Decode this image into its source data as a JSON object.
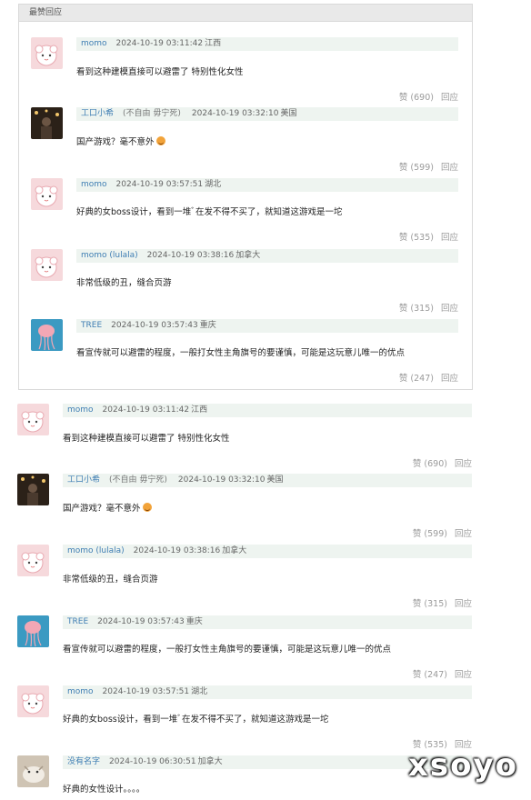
{
  "section_title": "最赞回应",
  "watermark": "xsoyo",
  "hot": [
    {
      "user": "momo",
      "sub": "",
      "time": "2024-10-19 03:11:42",
      "loc": "江西",
      "text": "看到这种建模直接可以避雷了 特别性化女性",
      "emoji": false,
      "likes": "赞 (690)",
      "reply": "回应",
      "avatar": "pink-blob"
    },
    {
      "user": "工口小希",
      "sub": "(不自由 毋宁死)",
      "time": "2024-10-19 03:32:10",
      "loc": "美国",
      "text": "国产游戏？毫不意外",
      "emoji": true,
      "likes": "赞 (599)",
      "reply": "回应",
      "avatar": "dark-photo"
    },
    {
      "user": "momo",
      "sub": "",
      "time": "2024-10-19 03:57:51",
      "loc": "湖北",
      "text": "好典的女boss设计，看到一堆ﾞ在发不得不买了，就知道这游戏是一坨",
      "emoji": false,
      "likes": "赞 (535)",
      "reply": "回应",
      "avatar": "pink-blob"
    },
    {
      "user": "momo (lulala)",
      "sub": "",
      "time": "2024-10-19 03:38:16",
      "loc": "加拿大",
      "text": "非常低级的丑，缝合页游",
      "emoji": false,
      "likes": "赞 (315)",
      "reply": "回应",
      "avatar": "pink-blob"
    },
    {
      "user": "TREE",
      "sub": "",
      "time": "2024-10-19 03:57:43",
      "loc": "重庆",
      "text": "看宣传就可以避雷的程度，一般打女性主角旗号的要谨慎，可能是这玩意儿唯一的优点",
      "emoji": false,
      "likes": "赞 (247)",
      "reply": "回应",
      "avatar": "jellyfish"
    }
  ],
  "all": [
    {
      "user": "momo",
      "sub": "",
      "time": "2024-10-19 03:11:42",
      "loc": "江西",
      "text": "看到这种建模直接可以避雷了 特别性化女性",
      "emoji": false,
      "likes": "赞 (690)",
      "reply": "回应",
      "avatar": "pink-blob"
    },
    {
      "user": "工口小希",
      "sub": "(不自由 毋宁死)",
      "time": "2024-10-19 03:32:10",
      "loc": "美国",
      "text": "国产游戏？毫不意外",
      "emoji": true,
      "likes": "赞 (599)",
      "reply": "回应",
      "avatar": "dark-photo"
    },
    {
      "user": "momo (lulala)",
      "sub": "",
      "time": "2024-10-19 03:38:16",
      "loc": "加拿大",
      "text": "非常低级的丑，缝合页游",
      "emoji": false,
      "likes": "赞 (315)",
      "reply": "回应",
      "avatar": "pink-blob"
    },
    {
      "user": "TREE",
      "sub": "",
      "time": "2024-10-19 03:57:43",
      "loc": "重庆",
      "text": "看宣传就可以避雷的程度，一般打女性主角旗号的要谨慎，可能是这玩意儿唯一的优点",
      "emoji": false,
      "likes": "赞 (247)",
      "reply": "回应",
      "avatar": "jellyfish"
    },
    {
      "user": "momo",
      "sub": "",
      "time": "2024-10-19 03:57:51",
      "loc": "湖北",
      "text": "好典的女boss设计，看到一堆ﾞ在发不得不买了，就知道这游戏是一坨",
      "emoji": false,
      "likes": "赞 (535)",
      "reply": "回应",
      "avatar": "pink-blob"
    },
    {
      "user": "没有名字",
      "sub": "",
      "time": "2024-10-19 06:30:51",
      "loc": "加拿大",
      "text": "好典的女性设计。。。。",
      "emoji": false,
      "likes": "",
      "reply": "",
      "avatar": "cat-photo"
    }
  ]
}
